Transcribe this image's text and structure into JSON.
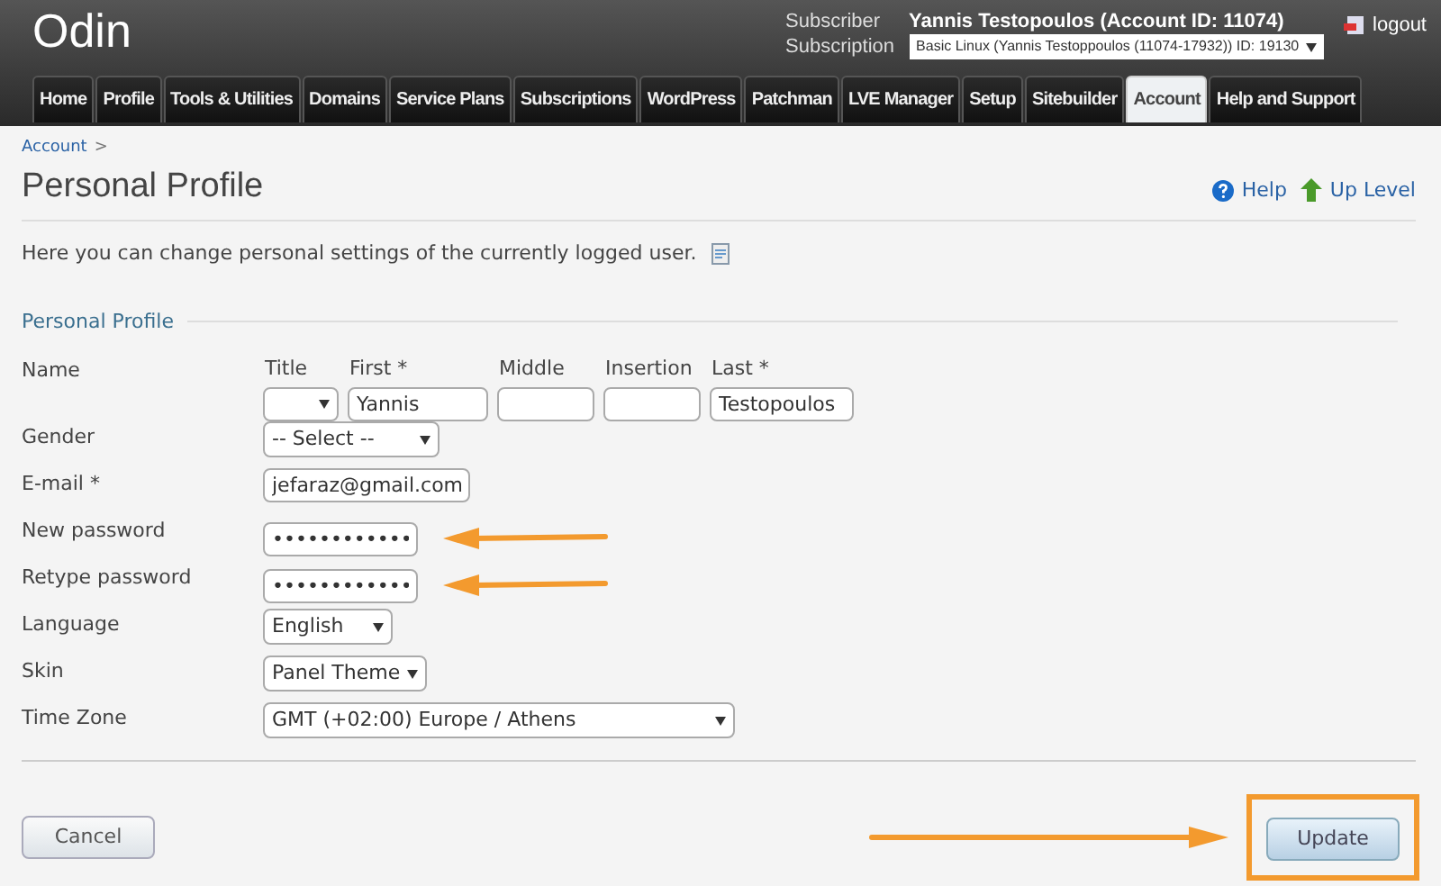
{
  "header": {
    "logo": "Odin",
    "subscriber_label": "Subscriber",
    "subscriber_value": "Yannis Testopoulos (Account ID: 11074)",
    "subscription_label": "Subscription",
    "subscription_value": "Basic Linux (Yannis Testoppoulos (11074-17932)) ID: 19130",
    "logout": "logout"
  },
  "tabs": [
    {
      "label": "Home",
      "selected": false
    },
    {
      "label": "Profile",
      "selected": false
    },
    {
      "label": "Tools & Utilities",
      "selected": false
    },
    {
      "label": "Domains",
      "selected": false
    },
    {
      "label": "Service Plans",
      "selected": false
    },
    {
      "label": "Subscriptions",
      "selected": false
    },
    {
      "label": "WordPress",
      "selected": false
    },
    {
      "label": "Patchman",
      "selected": false
    },
    {
      "label": "LVE Manager",
      "selected": false
    },
    {
      "label": "Setup",
      "selected": false
    },
    {
      "label": "Sitebuilder",
      "selected": false
    },
    {
      "label": "Account",
      "selected": true
    },
    {
      "label": "Help and Support",
      "selected": false
    }
  ],
  "breadcrumb": {
    "link": "Account",
    "separator": ">"
  },
  "title": "Personal Profile",
  "help": "Help",
  "up_level": "Up Level",
  "intro": "Here you can change personal settings of the currently logged user.",
  "section": "Personal Profile",
  "fields": [
    {
      "kind": "name",
      "label": "Name",
      "parts": [
        {
          "kind": "select",
          "label": "Title"
        },
        {
          "kind": "text",
          "label": "First *",
          "value": "Yannis"
        },
        {
          "kind": "text",
          "label": "Middle"
        },
        {
          "kind": "text",
          "label": "Insertion"
        },
        {
          "kind": "text",
          "label": "Last *",
          "value": "Testopoulos"
        }
      ]
    },
    {
      "kind": "select",
      "label": "Gender",
      "value": "-- Select --"
    },
    {
      "kind": "text",
      "label": "E-mail *",
      "value": "jefaraz@gmail.com"
    },
    {
      "kind": "password",
      "label": "New password",
      "value": "••••••••••••"
    },
    {
      "kind": "password",
      "label": "Retype password",
      "value": "••••••••••••"
    },
    {
      "kind": "select",
      "label": "Language",
      "value": "English"
    },
    {
      "kind": "select",
      "label": "Skin",
      "value": "Panel Theme"
    },
    {
      "kind": "wideselect",
      "label": "Time Zone",
      "value": "GMT (+02:00) Europe / Athens"
    }
  ],
  "buttons": {
    "cancel": "Cancel",
    "update": {
      "label": "Update",
      "highlighted": true
    }
  }
}
